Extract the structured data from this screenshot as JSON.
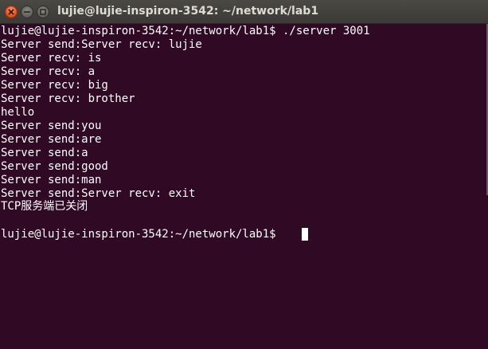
{
  "window": {
    "title": "lujie@lujie-inspiron-3542: ~/network/lab1",
    "controls": {
      "close_icon": "close-icon",
      "minimize_icon": "minimize-icon",
      "maximize_icon": "maximize-icon"
    }
  },
  "terminal": {
    "background_color": "#300a24",
    "text_color": "#ffffff",
    "lines": [
      "lujie@lujie-inspiron-3542:~/network/lab1$ ./server 3001",
      "Server send:Server recv: lujie",
      "Server recv: is",
      "Server recv: a",
      "Server recv: big",
      "Server recv: brother",
      "hello",
      "Server send:you",
      "Server send:are",
      "Server send:a",
      "Server send:good",
      "Server send:man",
      "Server send:Server recv: exit",
      "TCP服务端已关闭",
      "",
      "lujie@lujie-inspiron-3542:~/network/lab1$ "
    ]
  }
}
